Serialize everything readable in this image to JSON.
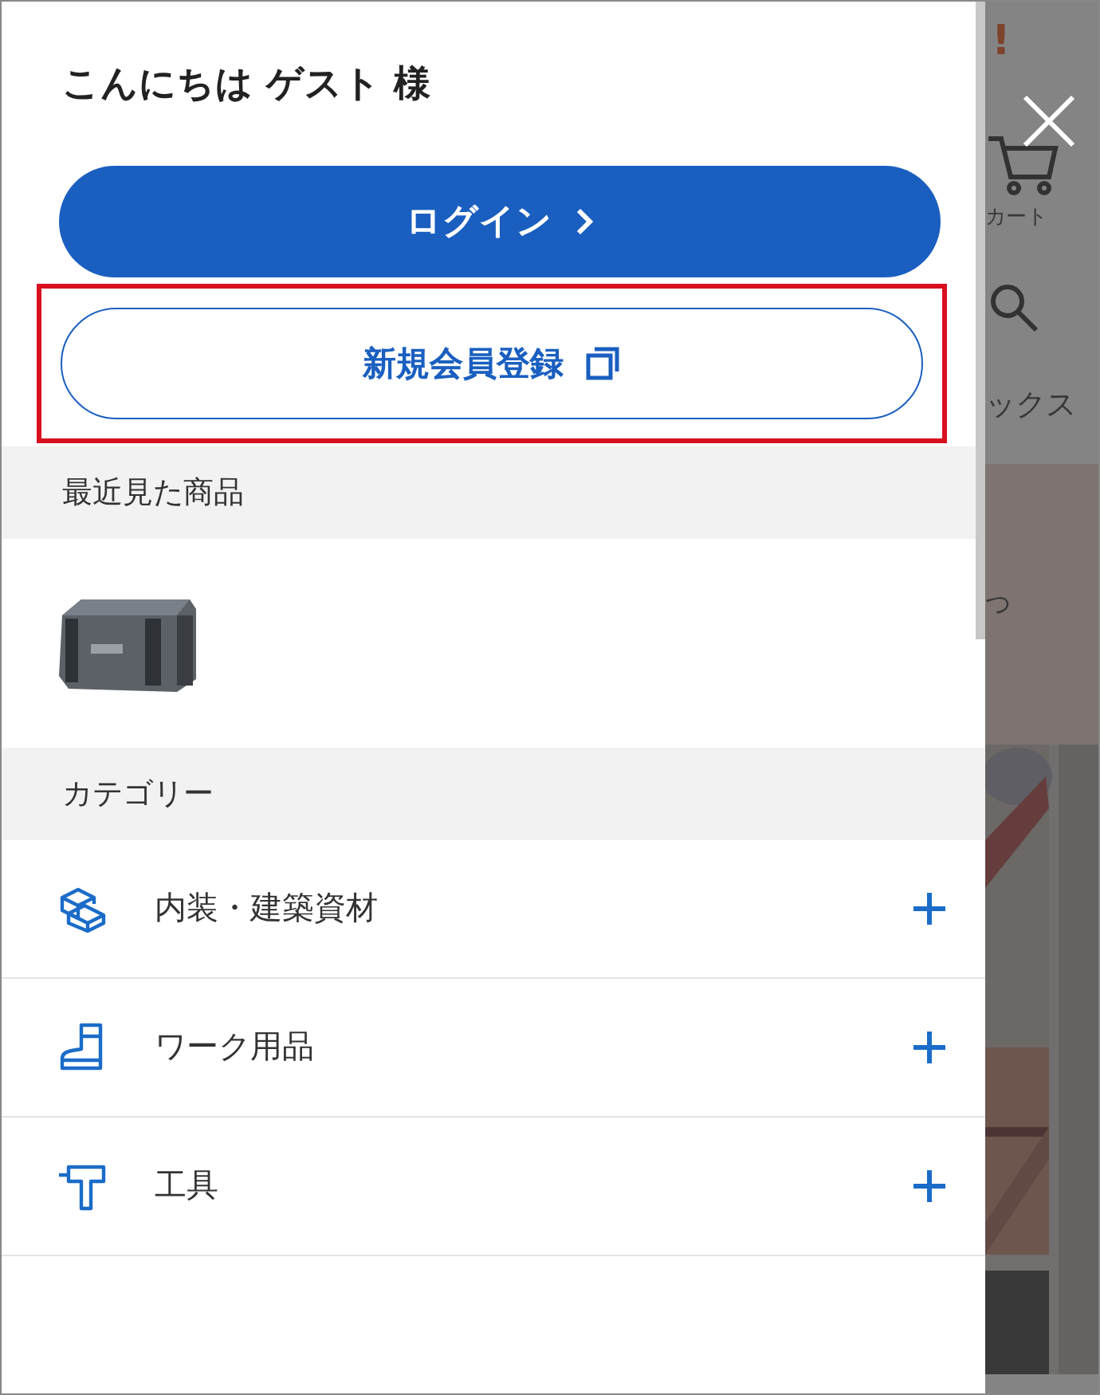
{
  "greeting": "こんにちは ゲスト 様",
  "login_button": {
    "label": "ログイン"
  },
  "register_button": {
    "label": "新規会員登録",
    "highlighted": true
  },
  "recent": {
    "title": "最近見た商品"
  },
  "categories": {
    "title": "カテゴリー",
    "items": [
      {
        "kind": "boxes",
        "label": "内装・建築資材",
        "expanded": false
      },
      {
        "kind": "boot",
        "label": "ワーク用品",
        "expanded": false
      },
      {
        "kind": "drill",
        "label": "工具",
        "expanded": false
      }
    ]
  },
  "background": {
    "alert": "!",
    "cart_label": "カート",
    "search_label": "ックス",
    "banner_text": "つ"
  }
}
